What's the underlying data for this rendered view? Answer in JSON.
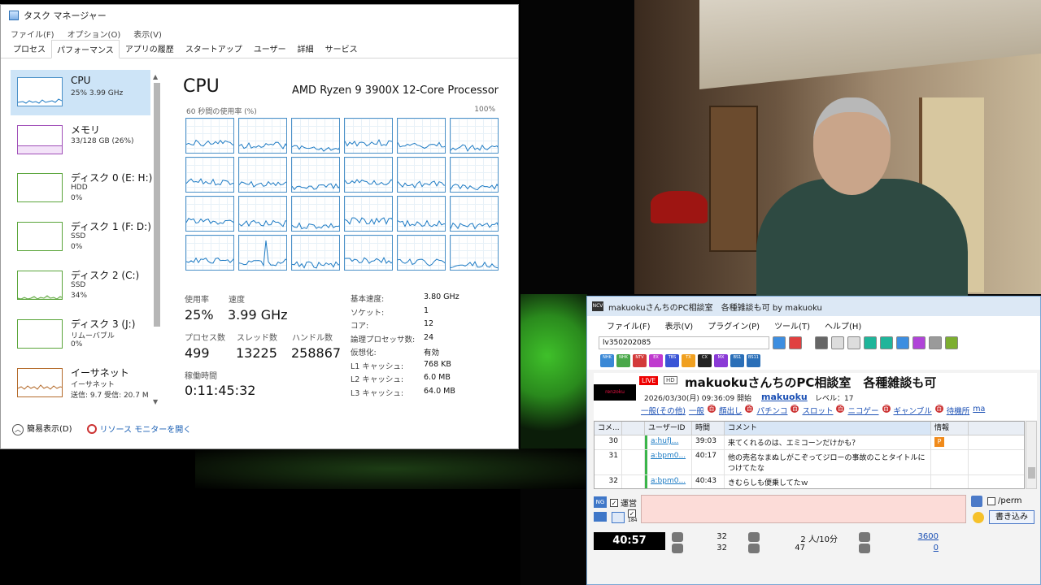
{
  "taskmgr": {
    "title": "タスク マネージャー",
    "menu": [
      "ファイル(F)",
      "オプション(O)",
      "表示(V)"
    ],
    "tabs": [
      "プロセス",
      "パフォーマンス",
      "アプリの履歴",
      "スタートアップ",
      "ユーザー",
      "詳細",
      "サービス"
    ],
    "active_tab": "パフォーマンス",
    "resources": [
      {
        "name": "CPU",
        "line1": "25% 3.99 GHz",
        "line2": ""
      },
      {
        "name": "メモリ",
        "line1": "33/128 GB (26%)",
        "line2": ""
      },
      {
        "name": "ディスク 0 (E: H:)",
        "line1": "HDD",
        "line2": "0%"
      },
      {
        "name": "ディスク 1 (F: D:)",
        "line1": "SSD",
        "line2": "0%"
      },
      {
        "name": "ディスク 2 (C:)",
        "line1": "SSD",
        "line2": "34%"
      },
      {
        "name": "ディスク 3 (J:)",
        "line1": "リムーバブル",
        "line2": "0%"
      },
      {
        "name": "イーサネット",
        "line1": "イーサネット",
        "line2": "送信: 9.7  受信: 20.7 M"
      }
    ],
    "cpu": {
      "title": "CPU",
      "model": "AMD Ryzen 9 3900X 12-Core Processor",
      "graph_label": "60 秒間の使用率 (%)",
      "graph_max": "100%",
      "stats": {
        "usage_label": "使用率",
        "usage": "25%",
        "speed_label": "速度",
        "speed": "3.99 GHz",
        "process_label": "プロセス数",
        "process": "499",
        "thread_label": "スレッド数",
        "thread": "13225",
        "handle_label": "ハンドル数",
        "handle": "258867",
        "uptime_label": "稼働時間",
        "uptime": "0:11:45:32"
      },
      "specs": [
        {
          "k": "基本速度:",
          "v": "3.80 GHz"
        },
        {
          "k": "ソケット:",
          "v": "1"
        },
        {
          "k": "コア:",
          "v": "12"
        },
        {
          "k": "論理プロセッサ数:",
          "v": "24"
        },
        {
          "k": "仮想化:",
          "v": "有効"
        },
        {
          "k": "L1 キャッシュ:",
          "v": "768 KB"
        },
        {
          "k": "L2 キャッシュ:",
          "v": "6.0 MB"
        },
        {
          "k": "L3 キャッシュ:",
          "v": "64.0 MB"
        }
      ]
    },
    "footer": {
      "compact": "簡易表示(D)",
      "monitor": "リソース モニターを開く"
    }
  },
  "viewer": {
    "title": "makuokuさんちのPC相談室　各種雑談も可 by makuoku",
    "menu": [
      "ファイル(F)",
      "表示(V)",
      "プラグイン(P)",
      "ツール(T)",
      "ヘルプ(H)"
    ],
    "live_id": "lv350202085",
    "channels": [
      "NHK",
      "NHK",
      "NTV",
      "EX",
      "TBS",
      "TX",
      "CX",
      "MX",
      "BS1",
      "BS11"
    ],
    "thumb_text": "renzoku",
    "live_badge": "LIVE",
    "hd_badge": "HD",
    "program_title": "makuokuさんちのPC相談室　各種雑談も可",
    "start_text": "2026/03/30(月) 09:36:09 開始",
    "owner": "makuoku",
    "level": "レベル：17",
    "tags": [
      "一般(その他)",
      "一般",
      "顔出し",
      "パチンコ",
      "スロット",
      "ニコゲー",
      "ギャンブル",
      "待機所",
      "ma"
    ],
    "columns": [
      "コメ...",
      "",
      "ユーザーID",
      "時間",
      "コメント",
      "情報"
    ],
    "comments": [
      {
        "no": "30",
        "user": "a:hufJ...",
        "time": "39:03",
        "text": "来てくれるのは、エミコーンだけかも？"
      },
      {
        "no": "31",
        "user": "a:bpm0...",
        "time": "40:17",
        "text": "他の売名なまぬしがこぞってジローの事故のことタイトルにつけてたな"
      },
      {
        "no": "32",
        "user": "a:bpm0...",
        "time": "40:43",
        "text": "きむらしも便乗してたｗ"
      }
    ],
    "compose": {
      "ng": "NG",
      "unei": "運営",
      "perm": "/perm",
      "write": "書き込み",
      "bsp": "184"
    },
    "status": {
      "elapsed": "40:57",
      "comments_a": "32",
      "comments_b": "32",
      "viewers": "2 人/10分",
      "viewers_b": "47",
      "points_a": "3600",
      "points_b": "0"
    }
  }
}
